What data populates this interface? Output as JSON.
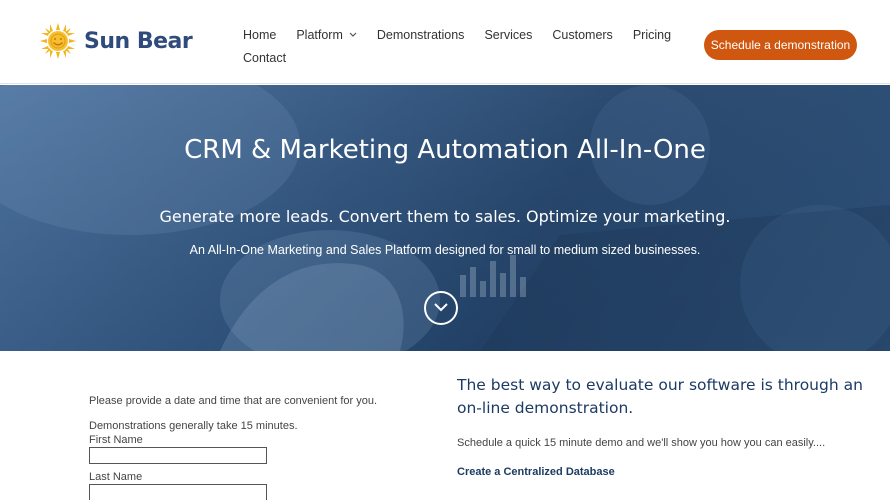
{
  "brand": {
    "name": "Sun Bear",
    "accent_color": "#d0570f",
    "logo_icon": "sun-icon"
  },
  "nav": {
    "items": [
      {
        "label": "Home"
      },
      {
        "label": "Platform",
        "has_dropdown": true
      },
      {
        "label": "Demonstrations"
      },
      {
        "label": "Services"
      },
      {
        "label": "Customers"
      },
      {
        "label": "Pricing"
      },
      {
        "label": "Contact"
      }
    ],
    "cta_label": "Schedule a demonstration"
  },
  "hero": {
    "title": "CRM & Marketing Automation All-In-One",
    "subtitle": "Generate more leads. Convert them to sales. Optimize your marketing.",
    "description": "An All-In-One Marketing and Sales Platform designed for small to medium sized businesses.",
    "scroll_icon": "chevron-down-circle-icon"
  },
  "form": {
    "intro": "Please provide a date and time that are convenient for you.",
    "note": "Demonstrations generally take 15 minutes.",
    "fields": [
      {
        "label": "First Name",
        "value": ""
      },
      {
        "label": "Last Name",
        "value": ""
      }
    ]
  },
  "info": {
    "heading": "The best way to evaluate our software is through an on-line demonstration.",
    "paragraph": "Schedule a quick 15 minute demo and we'll show you how you can easily....",
    "subheading": "Create a Centralized Database"
  }
}
